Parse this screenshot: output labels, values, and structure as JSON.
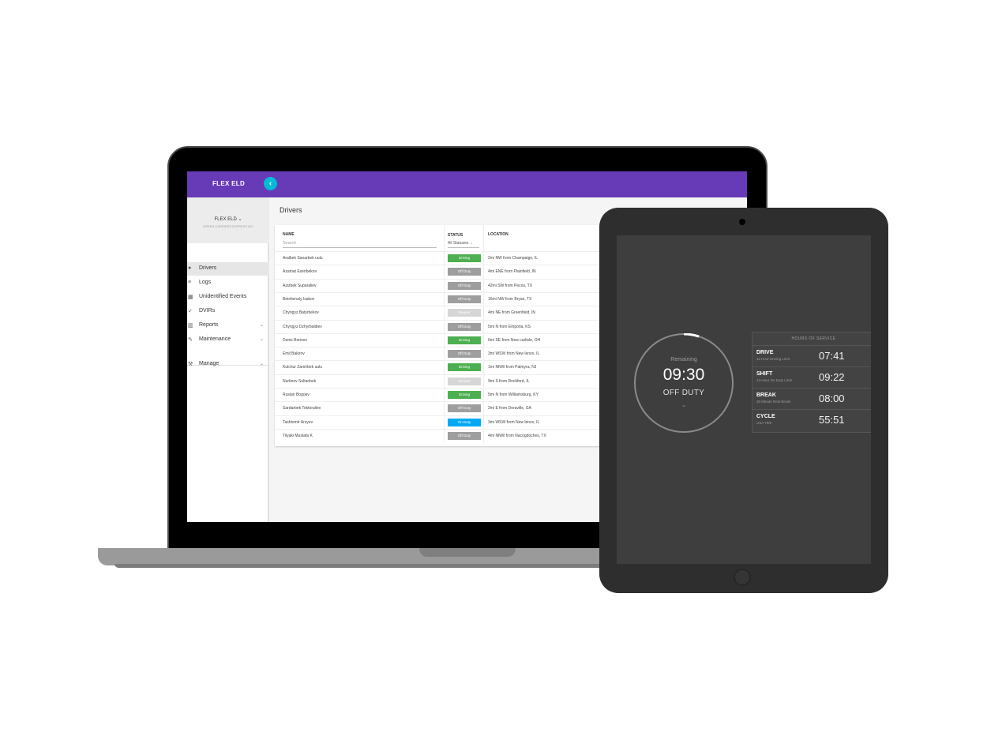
{
  "colors": {
    "brand_purple": "#673ab7",
    "accent_cyan": "#00bcd4",
    "status_driving": "#4caf50",
    "status_off_duty": "#9e9e9e",
    "status_sleeper": "#d6d6d6",
    "status_on_duty": "#03a9f4"
  },
  "app": {
    "brand": "FLEX ELD",
    "org_name": "FLEX ELD",
    "org_sub": "GREEN CARRIERS EXPRESS INC"
  },
  "sidebar": {
    "items": [
      {
        "label": "Drivers",
        "icon": "person-icon"
      },
      {
        "label": "Logs",
        "icon": "list-icon"
      },
      {
        "label": "Unidentified Events",
        "icon": "calendar-icon"
      },
      {
        "label": "DVIRs",
        "icon": "check-icon"
      },
      {
        "label": "Reports",
        "icon": "chart-icon"
      },
      {
        "label": "Maintenance",
        "icon": "wrench-icon"
      },
      {
        "label": "Manage",
        "icon": "tools-icon"
      }
    ]
  },
  "main": {
    "title": "Drivers",
    "columns": {
      "name": "NAME",
      "status": "STATUS",
      "location": "LOCATION"
    },
    "search_placeholder": "Search",
    "status_filter": "All Statuses",
    "rows": [
      {
        "name": "Aralbek Sanarbek uulu",
        "status": "Driving",
        "location": "2mi NW from Champaign, IL"
      },
      {
        "name": "Azamat Esenbekov",
        "status": "Off Duty",
        "location": "4mi ENE from Plainfield, IN"
      },
      {
        "name": "Azizbek Suparaliev",
        "status": "Off Duty",
        "location": "42mi SW from Pecos, TX"
      },
      {
        "name": "Beishenaly Isakov",
        "status": "Off Duty",
        "location": "16mi NW from Bryan, TX"
      },
      {
        "name": "Chyngyz Batyrbekov",
        "status": "Sleeper",
        "location": "4mi NE from Greenfield, IN"
      },
      {
        "name": "Chyngyz Dzhyrbaldiev",
        "status": "Off Duty",
        "location": "5mi N from Emporia, KS"
      },
      {
        "name": "Denis Borisov",
        "status": "Driving",
        "location": "6mi SE from New carlisle, OH"
      },
      {
        "name": "Emil Bakirov",
        "status": "Off Duty",
        "location": "3mi WSW from New lenox, IL"
      },
      {
        "name": "Kulchur Zamirbek uulu",
        "status": "Driving",
        "location": "1mi NNW from Palmyra, NJ"
      },
      {
        "name": "Nurkeev Sultanbek",
        "status": "Sleeper",
        "location": "9mi S from Rockford, IL"
      },
      {
        "name": "Ruslan Bogoev",
        "status": "Driving",
        "location": "5mi N from Williamsburg, KY"
      },
      {
        "name": "Sardarbek Toktoraliev",
        "status": "Off Duty",
        "location": "2mi E from Doraville, GA"
      },
      {
        "name": "Tashtemir Arzyev",
        "status": "On Duty",
        "location": "3mi WSW from New lenox, IL"
      },
      {
        "name": "Tilyaki Mustafa K",
        "status": "Off Duty",
        "location": "4mi NNW from Nacogdoches, TX"
      }
    ]
  },
  "tablet": {
    "remaining_label": "Remaining",
    "remaining_time": "09:30",
    "duty_status": "OFF DUTY",
    "progress_fraction": 0.05,
    "hos": {
      "header": "HOURS OF SERVICE",
      "rows": [
        {
          "name": "DRIVE",
          "sub": "11-Hour Driving Limit",
          "value": "07:41"
        },
        {
          "name": "SHIFT",
          "sub": "14-Hour On Duty Limit",
          "value": "09:22"
        },
        {
          "name": "BREAK",
          "sub": "30 Minute Rest Break",
          "value": "08:00"
        },
        {
          "name": "CYCLE",
          "sub": "USA 70/8",
          "value": "55:51"
        }
      ]
    }
  }
}
